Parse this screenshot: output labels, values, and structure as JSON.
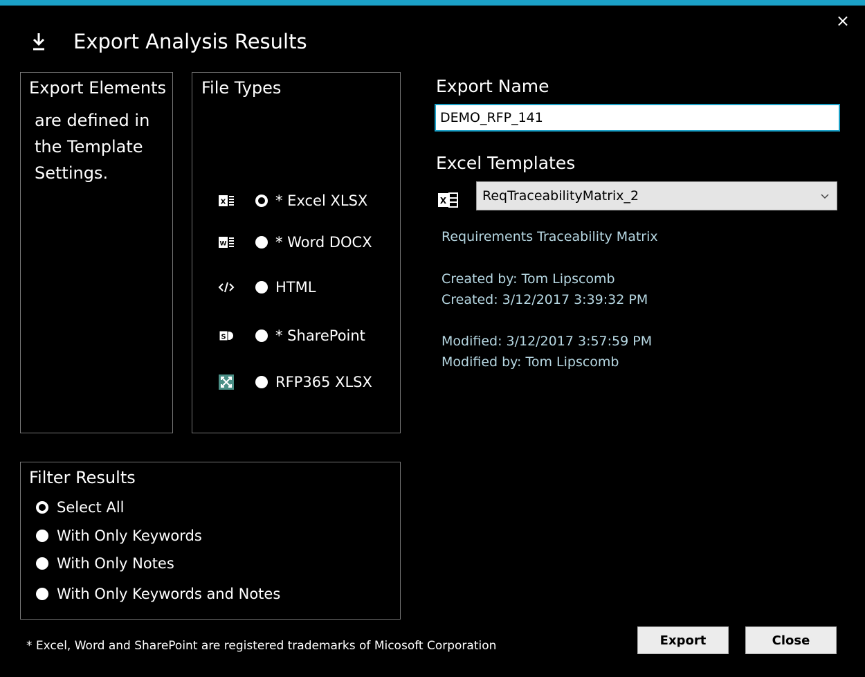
{
  "window": {
    "title": "Export Analysis Results",
    "close_glyph": "×",
    "accent_color": "#1ba1c8"
  },
  "export_elements": {
    "title": "Export Elements",
    "description": "are defined in the Template Settings."
  },
  "file_types": {
    "title": "File Types",
    "items": [
      {
        "label": "* Excel XLSX",
        "icon": "excel-icon",
        "checked": true
      },
      {
        "label": "* Word DOCX",
        "icon": "word-icon",
        "checked": false
      },
      {
        "label": "HTML",
        "icon": "code-icon",
        "checked": false
      },
      {
        "label": "* SharePoint",
        "icon": "sharepoint-icon",
        "checked": false
      },
      {
        "label": "RFP365 XLSX",
        "icon": "rfp365-icon",
        "checked": false
      }
    ]
  },
  "filter_results": {
    "title": "Filter Results",
    "items": [
      {
        "label": "Select All",
        "checked": true
      },
      {
        "label": "With Only Keywords",
        "checked": false
      },
      {
        "label": "With Only Notes",
        "checked": false
      },
      {
        "label": "With Only Keywords and Notes",
        "checked": false
      }
    ]
  },
  "export_name": {
    "label": "Export Name",
    "value": "DEMO_RFP_141"
  },
  "excel_templates": {
    "label": "Excel Templates",
    "selected": "ReqTraceabilityMatrix_2",
    "description": "Requirements Traceability Matrix",
    "created_by": "Created by: Tom Lipscomb",
    "created": "Created: 3/12/2017 3:39:32 PM",
    "modified": "Modified: 3/12/2017 3:57:59 PM",
    "modified_by": "Modified by: Tom Lipscomb"
  },
  "footnote": "* Excel, Word and SharePoint are registered trademarks of Micosoft Corporation",
  "buttons": {
    "export": "Export",
    "close": "Close"
  }
}
